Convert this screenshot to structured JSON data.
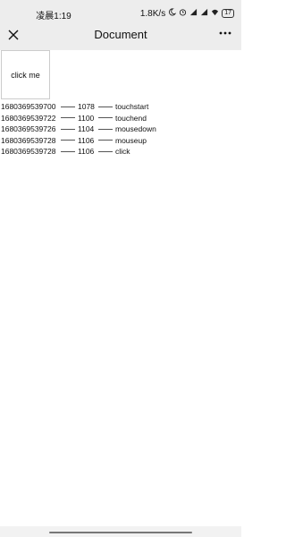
{
  "status": {
    "time": "凌晨1:19",
    "net_speed": "1.8K/s",
    "battery": "17"
  },
  "nav": {
    "title": "Document"
  },
  "button": {
    "label": "click me"
  },
  "log": [
    {
      "ts": "1680369539700",
      "dur": "1078",
      "event": "touchstart"
    },
    {
      "ts": "1680369539722",
      "dur": "1100",
      "event": "touchend"
    },
    {
      "ts": "1680369539726",
      "dur": "1104",
      "event": "mousedown"
    },
    {
      "ts": "1680369539728",
      "dur": "1106",
      "event": "mouseup"
    },
    {
      "ts": "1680369539728",
      "dur": "1106",
      "event": "click"
    }
  ],
  "colors": {
    "header_bg": "#ededed",
    "page_bg": "#ffffff",
    "box_border": "#cccccc"
  }
}
